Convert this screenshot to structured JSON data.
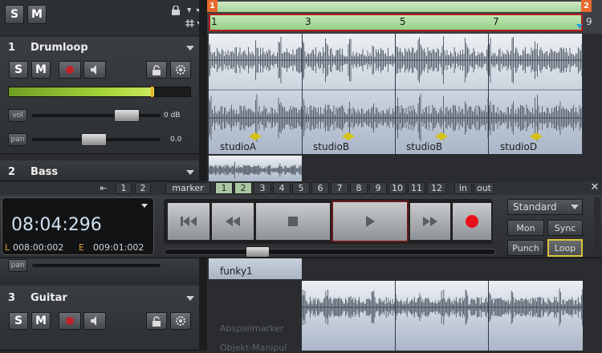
{
  "top_buttons": {
    "solo": "S",
    "mute": "M"
  },
  "ruler": {
    "marks": [
      "1",
      "3",
      "5",
      "7",
      "9"
    ],
    "loop_start": "1",
    "loop_end": "2"
  },
  "tracks": [
    {
      "number": "1",
      "name": "Drumloop",
      "solo": "S",
      "mute": "M",
      "vol_label": "vol",
      "vol_value": "0 dB",
      "pan_label": "pan",
      "pan_value": "0.0",
      "meter_level": 0.8
    },
    {
      "number": "2",
      "name": "Bass",
      "pan_label": "pan"
    },
    {
      "number": "3",
      "name": "Guitar",
      "solo": "S",
      "mute": "M"
    }
  ],
  "clips": {
    "drum": [
      "studioA",
      "studioB",
      "studioB",
      "studioD"
    ],
    "bass": "funky1"
  },
  "marker_bar": {
    "label": "marker",
    "numbers": [
      "1",
      "2",
      "3",
      "4",
      "5",
      "6",
      "7",
      "8",
      "9",
      "10",
      "11",
      "12"
    ],
    "prev_nums": [
      "1",
      "2"
    ],
    "in": "in",
    "out": "out",
    "highlight": [
      "1",
      "2"
    ]
  },
  "transport": {
    "time": "08:04:296",
    "l_label": "L",
    "l_value": "008:00:002",
    "e_label": "E",
    "e_value": "009:01:002",
    "mode": "Standard",
    "buttons": {
      "mon": "Mon",
      "sync": "Sync",
      "punch": "Punch",
      "loop": "Loop"
    },
    "record_color": "#e8121c"
  },
  "lower_text": [
    "Abspielmarker",
    "Objekt-Manipul"
  ]
}
